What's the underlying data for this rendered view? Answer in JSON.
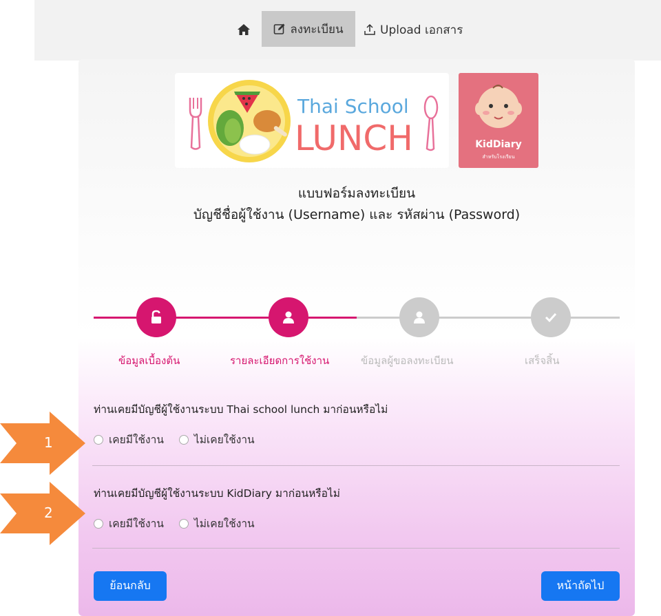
{
  "navbar": {
    "home_icon": "home-icon",
    "register_label": "ลงทะเบียน",
    "register_icon": "edit-icon",
    "upload_label": "Upload เอกสาร",
    "upload_icon": "upload-icon"
  },
  "logos": {
    "tsl_line1": "Thai School",
    "tsl_line2": "LUNCH",
    "kid_name": "KidDiary",
    "kid_sub": "สำหรับโรงเรียน"
  },
  "form": {
    "title_line1": "แบบฟอร์มลงทะเบียน",
    "title_line2": "บัญชีชื่อผู้ใช้งาน (Username) และ รหัสผ่าน (Password)"
  },
  "steps": [
    {
      "label": "ข้อมูลเบื้องต้น",
      "icon": "unlock-icon",
      "state": "done"
    },
    {
      "label": "รายละเอียดการใช้งาน",
      "icon": "user-icon",
      "state": "active"
    },
    {
      "label": "ข้อมูลผู้ขอลงทะเบียน",
      "icon": "user-icon",
      "state": "pending"
    },
    {
      "label": "เสร็จสิ้น",
      "icon": "check-icon",
      "state": "pending"
    }
  ],
  "questions": [
    {
      "text": "ท่านเคยมีบัญชีผู้ใช้งานระบบ Thai school lunch มาก่อนหรือไม่",
      "options": [
        "เคยมีใช้งาน",
        "ไม่เคยใช้งาน"
      ]
    },
    {
      "text": "ท่านเคยมีบัญชีผู้ใช้งานระบบ KidDiary มาก่อนหรือไม่",
      "options": [
        "เคยมีใช้งาน",
        "ไม่เคยใช้งาน"
      ]
    }
  ],
  "buttons": {
    "back": "ย้อนกลับ",
    "next": "หน้าถัดไป"
  },
  "annotations": [
    {
      "number": "1"
    },
    {
      "number": "2"
    }
  ],
  "colors": {
    "accent": "#d6166f",
    "inactive": "#cccccc",
    "button": "#1677f2",
    "arrow": "#f58a3c"
  }
}
